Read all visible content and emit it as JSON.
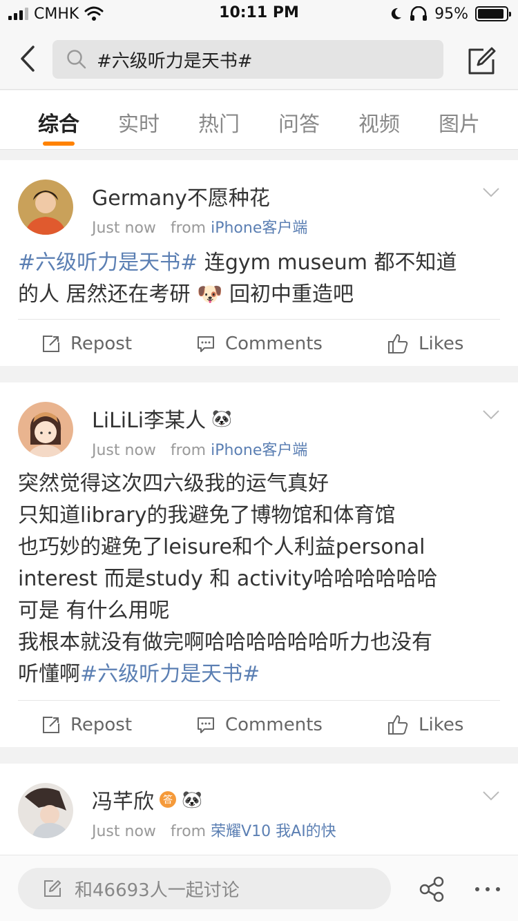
{
  "status_bar": {
    "carrier": "CMHK",
    "time": "10:11 PM",
    "battery": "95%",
    "battery_level": 0.95
  },
  "nav": {
    "search_query": "#六级听力是天书#"
  },
  "tabs": [
    "综合",
    "实时",
    "热门",
    "问答",
    "视频",
    "图片"
  ],
  "active_tab": 0,
  "posts": [
    {
      "username": "Germany不愿种花",
      "time": "Just now",
      "from": "from",
      "source": "iPhone客户端",
      "lines": [
        {
          "tag": "#六级听力是天书#",
          "text": " 连gym museum 都不知道"
        },
        {
          "text": "的人 居然还在考研 🐶 回初中重造吧"
        }
      ]
    },
    {
      "username": "LiLiLi李某人",
      "badge": "🐼",
      "time": "Just now",
      "from": "from",
      "source": "iPhone客户端",
      "lines": [
        {
          "text": "突然觉得这次四六级我的运气真好"
        },
        {
          "text": "只知道library的我避免了博物馆和体育馆"
        },
        {
          "text": "也巧妙的避免了leisure和个人利益personal"
        },
        {
          "text": "interest 而是study 和 activity哈哈哈哈哈哈"
        },
        {
          "text": "可是 有什么用呢"
        },
        {
          "text": "我根本就没有做完啊哈哈哈哈哈哈听力也没有"
        },
        {
          "text": "听懂啊",
          "tag": "#六级听力是天书#"
        }
      ]
    },
    {
      "username": "冯芊欣",
      "badge": "🐼",
      "badge2": "答",
      "time": "Just now",
      "from": "from",
      "source": "荣耀V10 我AI的快"
    }
  ],
  "actions": {
    "repost": "Repost",
    "comments": "Comments",
    "likes": "Likes"
  },
  "bottom": {
    "discuss": "和46693人一起讨论"
  },
  "colors": {
    "accent": "#ff8200",
    "link": "#5b7fb3"
  }
}
